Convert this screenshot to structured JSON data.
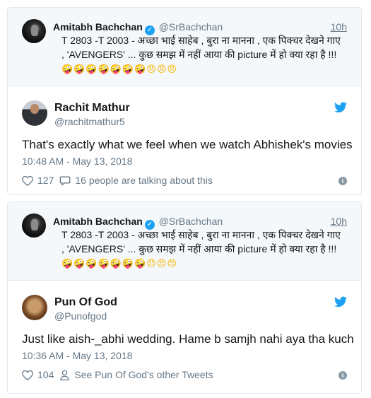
{
  "cards": [
    {
      "quoted": {
        "name": "Amitabh Bachchan",
        "handle": "@SrBachchan",
        "time": "10h",
        "text": "T 2803 -T 2003 - अच्छा भाई साहेब , बुरा ना मानना , एक पिक्चर देखने गाए , 'AVENGERS' ... कुछ समझ में नहीं आया की picture में हो क्या रहा है !!!",
        "emojis": "🤪🤪🤪🤪🤪🤪🤪😠😠😠"
      },
      "reply": {
        "name": "Rachit Mathur",
        "handle": "@rachitmathur5",
        "text": "That's exactly what we feel when we watch Abhishek's movies",
        "date": "10:48 AM - May 13, 2018",
        "likes": "127",
        "secondary": "16 people are talking about this"
      }
    },
    {
      "quoted": {
        "name": "Amitabh Bachchan",
        "handle": "@SrBachchan",
        "time": "10h",
        "text": "T 2803 -T 2003 - अच्छा भाई साहेब , बुरा ना मानना , एक पिक्चर देखने गाए , 'AVENGERS' ... कुछ समझ में नहीं आया की picture में हो क्या रहा है !!!",
        "emojis": "🤪🤪🤪🤪🤪🤪🤪😠😠😠"
      },
      "reply": {
        "name": "Pun Of God",
        "handle": "@Punofgod",
        "text": "Just like aish-_abhi wedding. Hame b samjh nahi aya tha kuch",
        "date": "10:36 AM - May 13, 2018",
        "likes": "104",
        "secondary": "See Pun Of God's other Tweets"
      }
    }
  ],
  "colors": {
    "twitter_blue": "#1da1f2",
    "muted": "#657786",
    "border": "#e1e8ed"
  },
  "icons": [
    "verified-badge-icon",
    "twitter-bird-icon",
    "heart-icon",
    "speech-bubble-icon",
    "person-icon",
    "info-icon"
  ]
}
